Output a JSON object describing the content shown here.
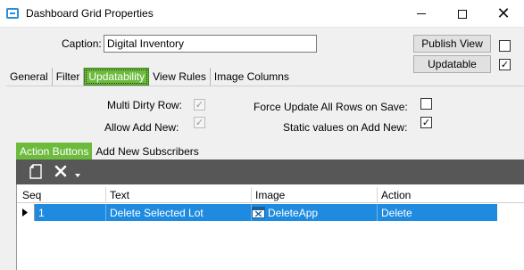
{
  "window": {
    "title": "Dashboard Grid Properties",
    "controls": {
      "minimize": "minimize-icon",
      "maximize": "maximize-icon",
      "close": "close-icon"
    }
  },
  "caption": {
    "label": "Caption:",
    "value": "Digital Inventory"
  },
  "buttons": {
    "publish_view": "Publish View",
    "updatable": "Updatable",
    "publish_checked": false,
    "updatable_checked": true
  },
  "tabs": [
    {
      "label": "General",
      "active": false
    },
    {
      "label": "Filter",
      "active": false
    },
    {
      "label": "Updatability",
      "active": true
    },
    {
      "label": "View Rules",
      "active": false
    },
    {
      "label": "Image Columns",
      "active": false
    }
  ],
  "options": {
    "multi_dirty_row": {
      "label": "Multi Dirty Row:",
      "checked": true,
      "enabled": false
    },
    "allow_add_new": {
      "label": "Allow Add New:",
      "checked": true,
      "enabled": false
    },
    "force_update_all": {
      "label": "Force Update All Rows on Save:",
      "checked": false
    },
    "static_values": {
      "label": "Static values on Add New:",
      "checked": true
    }
  },
  "subtabs": [
    {
      "label": "Action Buttons",
      "active": true
    },
    {
      "label": "Add New Subscribers",
      "active": false
    }
  ],
  "toolbar": {
    "icons": [
      "new-document-icon",
      "delete-icon",
      "dropdown-arrow-icon"
    ]
  },
  "grid": {
    "columns": [
      "Seq",
      "Text",
      "Image",
      "Action"
    ],
    "rows": [
      {
        "seq": "1",
        "text": "Delete Selected Lot",
        "image": "DeleteApp",
        "action": "Delete"
      }
    ]
  },
  "colors": {
    "accent_green": "#6dbb3d",
    "selection_blue": "#1e8be0",
    "toolbar_dark": "#575757",
    "window_icon_blue": "#2b8fd8"
  }
}
